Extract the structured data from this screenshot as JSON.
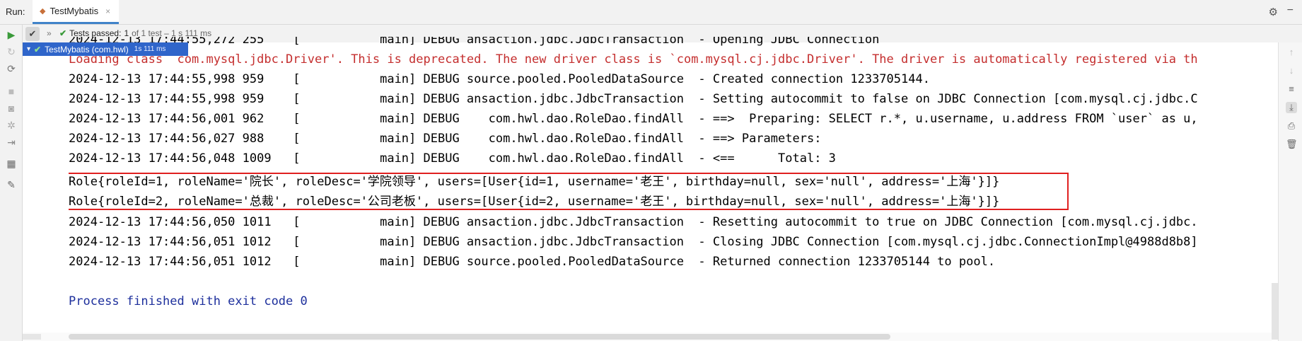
{
  "window": {
    "run_label": "Run:",
    "tab_name": "TestMybatis",
    "tab_close": "×",
    "icons": [
      "run-config-icon",
      "gear-icon",
      "minimize-icon"
    ]
  },
  "toolbar": {
    "chevron": "»",
    "status_prefix": "Tests passed:",
    "passed_count": "1",
    "status_detail": "of 1 test – 1 s 111 ms"
  },
  "tree": {
    "item_label": "TestMybatis (com.hwl)",
    "item_duration": "1s 111 ms"
  },
  "console": {
    "lines": [
      {
        "text": "2024-12-13 17:44:55,272 255    [           main] DEBUG ansaction.jdbc.JdbcTransaction  - Opening JDBC Connection",
        "type": "normal"
      },
      {
        "text": "Loading class `com.mysql.jdbc.Driver'. This is deprecated. The new driver class is `com.mysql.cj.jdbc.Driver'. The driver is automatically registered via th",
        "type": "error"
      },
      {
        "text": "2024-12-13 17:44:55,998 959    [           main] DEBUG source.pooled.PooledDataSource  - Created connection 1233705144.",
        "type": "normal"
      },
      {
        "text": "2024-12-13 17:44:55,998 959    [           main] DEBUG ansaction.jdbc.JdbcTransaction  - Setting autocommit to false on JDBC Connection [com.mysql.cj.jdbc.C",
        "type": "normal"
      },
      {
        "text": "2024-12-13 17:44:56,001 962    [           main] DEBUG    com.hwl.dao.RoleDao.findAll  - ==>  Preparing: SELECT r.*, u.username, u.address FROM `user` as u,",
        "type": "normal"
      },
      {
        "text": "2024-12-13 17:44:56,027 988    [           main] DEBUG    com.hwl.dao.RoleDao.findAll  - ==> Parameters: ",
        "type": "normal"
      },
      {
        "text": "2024-12-13 17:44:56,048 1009   [           main] DEBUG    com.hwl.dao.RoleDao.findAll  - <==      Total: 3",
        "type": "normal"
      },
      {
        "text": "Role{roleId=1, roleName='院长', roleDesc='学院领导', users=[User{id=1, username='老王', birthday=null, sex='null', address='上海'}]}",
        "type": "normal"
      },
      {
        "text": "Role{roleId=2, roleName='总裁', roleDesc='公司老板', users=[User{id=2, username='老王', birthday=null, sex='null', address='上海'}]}",
        "type": "normal"
      },
      {
        "text": "2024-12-13 17:44:56,050 1011   [           main] DEBUG ansaction.jdbc.JdbcTransaction  - Resetting autocommit to true on JDBC Connection [com.mysql.cj.jdbc.",
        "type": "normal"
      },
      {
        "text": "2024-12-13 17:44:56,051 1012   [           main] DEBUG ansaction.jdbc.JdbcTransaction  - Closing JDBC Connection [com.mysql.cj.jdbc.ConnectionImpl@4988d8b8]",
        "type": "normal"
      },
      {
        "text": "2024-12-13 17:44:56,051 1012   [           main] DEBUG source.pooled.PooledDataSource  - Returned connection 1233705144 to pool.",
        "type": "normal"
      },
      {
        "text": "",
        "type": "normal"
      },
      {
        "text": "Process finished with exit code 0",
        "type": "exit"
      }
    ]
  },
  "colors": {
    "error_text": "#c42e2e",
    "exit_text": "#1d2f9c",
    "highlight_border": "#e02020",
    "selected_node": "#2f65ca",
    "pass_green": "#3a9a3a"
  }
}
